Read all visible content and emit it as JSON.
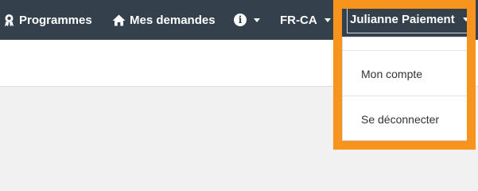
{
  "navbar": {
    "programmes_label": "Programmes",
    "demandes_label": "Mes demandes",
    "info_symbol": "i",
    "language_label": "FR-CA",
    "user_name": "Julianne Paiement"
  },
  "user_menu": {
    "items": [
      {
        "label": "Mon compte"
      },
      {
        "label": "Se déconnecter"
      }
    ]
  },
  "colors": {
    "navbar_bg": "#34404b",
    "highlight": "#f7941d",
    "page_bg": "#f1f1f1"
  },
  "icons": {
    "programmes": "award-icon",
    "demandes": "home-icon",
    "info": "info-icon"
  }
}
